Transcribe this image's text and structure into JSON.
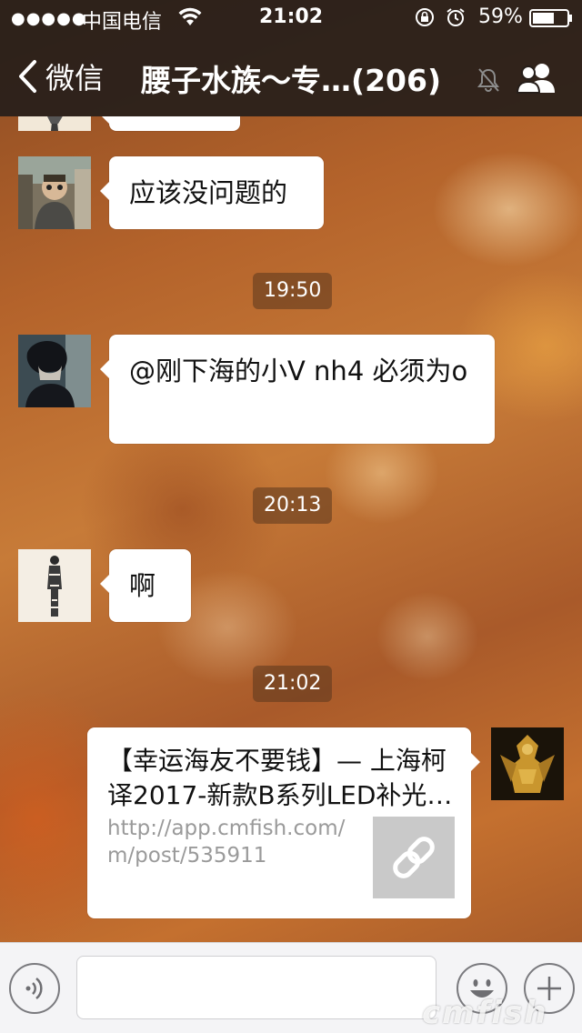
{
  "status_bar": {
    "signal": "●●●●●",
    "carrier": "中国电信",
    "time": "21:02",
    "battery": "59%"
  },
  "nav": {
    "back_label": "微信",
    "title": "腰子水族～专…(206)"
  },
  "messages": [
    {
      "type": "text",
      "side": "left",
      "text": "应该没问题的"
    },
    {
      "type": "timestamp",
      "text": "19:50"
    },
    {
      "type": "text",
      "side": "left",
      "text": "@刚下海的小V nh4 必须为o"
    },
    {
      "type": "timestamp",
      "text": "20:13"
    },
    {
      "type": "text",
      "side": "left",
      "text": "啊"
    },
    {
      "type": "timestamp",
      "text": "21:02"
    },
    {
      "type": "link",
      "side": "right",
      "title": "【幸运海友不要钱】— 上海柯译2017-新款B系列LED补光…",
      "url": "http://app.cmfish.com/m/post/535911"
    }
  ],
  "input_bar": {
    "placeholder": ""
  },
  "watermark": "cmfish",
  "colors": {
    "nav_bg": "#261e1a",
    "bubble_bg": "#ffffff",
    "link_thumb": "#c9c9c9"
  },
  "icons": [
    "wifi-icon",
    "lock-rotation-icon",
    "alarm-icon",
    "battery-icon",
    "chevron-left-icon",
    "mute-icon",
    "group-members-icon",
    "voice-icon",
    "emoji-icon",
    "plus-icon",
    "link-icon"
  ]
}
